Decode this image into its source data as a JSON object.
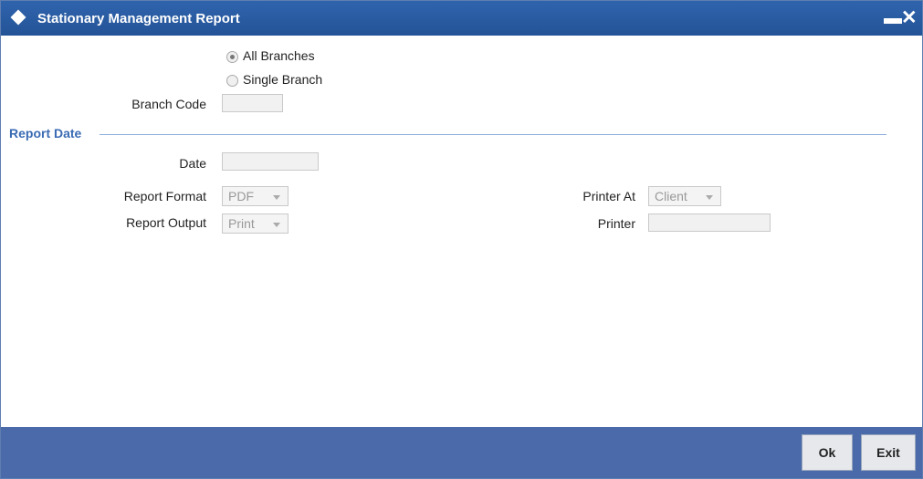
{
  "window": {
    "title": "Stationary Management Report",
    "minimize_label": "▬",
    "close_label": "✕"
  },
  "branch": {
    "options": [
      {
        "label": "All Branches",
        "checked": true
      },
      {
        "label": "Single Branch",
        "checked": false
      }
    ],
    "branch_code_label": "Branch Code",
    "branch_code_value": ""
  },
  "report_date": {
    "section_title": "Report Date",
    "date_label": "Date",
    "date_value": ""
  },
  "report": {
    "format_label": "Report Format",
    "format_value": "PDF",
    "output_label": "Report Output",
    "output_value": "Print",
    "printer_at_label": "Printer At",
    "printer_at_value": "Client",
    "printer_label": "Printer",
    "printer_value": ""
  },
  "footer": {
    "ok_label": "Ok",
    "exit_label": "Exit"
  }
}
